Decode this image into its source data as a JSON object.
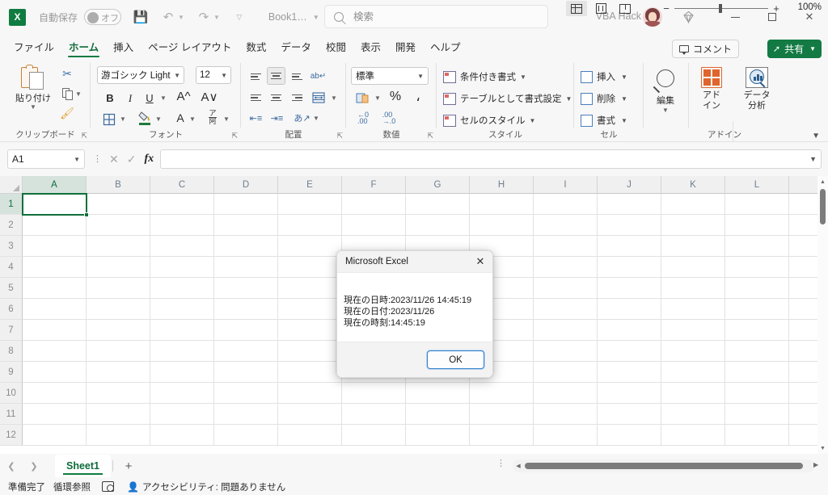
{
  "titlebar": {
    "app_icon": "excel-logo-icon",
    "autosave_label": "自動保存",
    "autosave_state": "オフ",
    "save_icon": "save-icon",
    "undo_icon": "undo-icon",
    "redo_icon": "redo-icon",
    "customize_icon": "customize-quick-access-icon",
    "doc_title": "Book1…",
    "search_placeholder": "検索",
    "search_value": "",
    "search_icon": "search-icon",
    "user_name": "VBA Hack",
    "avatar": "user-avatar",
    "diamond_icon": "diamond-icon",
    "minimize": "minimize-icon",
    "maximize": "maximize-icon",
    "close": "close-icon"
  },
  "ribbon_tabs": [
    {
      "label": "ファイル",
      "active": false
    },
    {
      "label": "ホーム",
      "active": true
    },
    {
      "label": "挿入",
      "active": false
    },
    {
      "label": "ページ レイアウト",
      "active": false
    },
    {
      "label": "数式",
      "active": false
    },
    {
      "label": "データ",
      "active": false
    },
    {
      "label": "校閲",
      "active": false
    },
    {
      "label": "表示",
      "active": false
    },
    {
      "label": "開発",
      "active": false
    },
    {
      "label": "ヘルプ",
      "active": false
    }
  ],
  "ribbon_right": {
    "comment_label": "コメント",
    "share_label": "共有"
  },
  "ribbon": {
    "clipboard": {
      "group_label": "クリップボード",
      "paste_label": "貼り付け",
      "cut_icon": "scissors-icon",
      "copy_icon": "copy-icon",
      "format_painter_icon": "format-painter-icon"
    },
    "font": {
      "group_label": "フォント",
      "font_name": "游ゴシック Light",
      "font_size": "12",
      "bold": "B",
      "italic": "I",
      "underline": "U",
      "grow_font": "A",
      "shrink_font": "A",
      "borders_icon": "borders-icon",
      "fill_color_icon": "fill-color-icon",
      "font_color_icon": "font-color-icon",
      "phonetic_icon": "phonetic-guide-icon"
    },
    "alignment": {
      "group_label": "配置",
      "top_align_icon": "align-top-icon",
      "middle_align_icon": "align-middle-icon",
      "bottom_align_icon": "align-bottom-icon",
      "wrap_text_icon": "wrap-text-icon",
      "align_left_icon": "align-left-icon",
      "align_center_icon": "align-center-icon",
      "align_right_icon": "align-right-icon",
      "merge_icon": "merge-cells-icon",
      "decrease_indent_icon": "decrease-indent-icon",
      "increase_indent_icon": "increase-indent-icon",
      "orientation_icon": "text-orientation-icon"
    },
    "number": {
      "group_label": "数値",
      "format_value": "標準",
      "accounting_icon": "accounting-format-icon",
      "percent_label": "%",
      "comma_label": "،",
      "decrease_decimal_icon": "decrease-decimal-icon",
      "increase_decimal_icon": "increase-decimal-icon"
    },
    "styles": {
      "group_label": "スタイル",
      "items": [
        "条件付き書式",
        "テーブルとして書式設定",
        "セルのスタイル"
      ]
    },
    "cells": {
      "group_label": "セル",
      "items": [
        "挿入",
        "削除",
        "書式"
      ]
    },
    "editing": {
      "group_label": "",
      "label": "編集",
      "find_icon": "find-select-icon"
    },
    "addins": {
      "group_label": "アドイン",
      "addin_label": "アド\nイン",
      "addin_label_line1": "アド",
      "addin_label_line2": "イン",
      "analysis_label_line1": "データ",
      "analysis_label_line2": "分析"
    }
  },
  "formula_bar": {
    "name_box": "A1",
    "cancel_icon": "cancel-icon",
    "enter_icon": "enter-icon",
    "function_icon": "insert-function-icon",
    "formula_value": "",
    "expand_icon": "expand-formula-bar-icon"
  },
  "grid": {
    "columns": [
      "A",
      "B",
      "C",
      "D",
      "E",
      "F",
      "G",
      "H",
      "I",
      "J",
      "K",
      "L"
    ],
    "rows": [
      "1",
      "2",
      "3",
      "4",
      "5",
      "6",
      "7",
      "8",
      "9",
      "10",
      "11",
      "12"
    ],
    "selected_cell": "A1",
    "selected_column": "A",
    "selected_row": "1"
  },
  "sheet_tabs": {
    "prev_icon": "previous-sheet-icon",
    "next_icon": "next-sheet-icon",
    "tabs": [
      {
        "label": "Sheet1",
        "active": true
      }
    ],
    "add_label": "+"
  },
  "status_bar": {
    "state": "準備完了",
    "circular_ref": "循環参照",
    "macro_icon": "record-macro-icon",
    "accessibility": "アクセシビリティ: 問題ありません",
    "view_normal_icon": "normal-view-icon",
    "view_page_layout_icon": "page-layout-view-icon",
    "view_page_break_icon": "page-break-preview-icon",
    "zoom_out": "−",
    "zoom_in": "+",
    "zoom_level": "100%"
  },
  "dialog": {
    "title": "Microsoft Excel",
    "close_icon": "close-icon",
    "lines": [
      "現在の日時:2023/11/26 14:45:19",
      "現在の日付:2023/11/26",
      "現在の時刻:14:45:19"
    ],
    "ok_label": "OK"
  },
  "colors": {
    "excel_green": "#107c41",
    "share_green": "#137a43",
    "accent_blue": "#2f7fd1",
    "addin_orange": "#e0642d"
  }
}
